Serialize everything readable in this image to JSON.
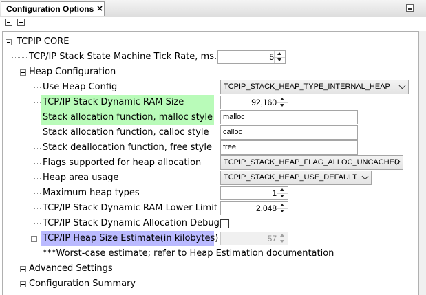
{
  "panel": {
    "title": "Configuration Options",
    "close_glyph": "×",
    "collapse_all_icon": "minus-box-icon",
    "expand_all_icon": "plus-box-icon"
  },
  "tree": {
    "root_label": "TCPIP CORE",
    "tick_rate": {
      "label": "TCP/IP Stack State Machine Tick Rate, ms.",
      "value": "5"
    },
    "heap_config": {
      "label": "Heap Configuration",
      "use_heap_config": {
        "label": "Use Heap Config",
        "value": "TCPIP_STACK_HEAP_TYPE_INTERNAL_HEAP"
      },
      "dynamic_ram_size": {
        "label": "TCP/IP Stack Dynamic RAM Size",
        "value": "92,160"
      },
      "malloc_func": {
        "label": "Stack allocation function, malloc style",
        "value": "malloc"
      },
      "calloc_func": {
        "label": "Stack allocation function, calloc style",
        "value": "calloc"
      },
      "free_func": {
        "label": "Stack deallocation function, free style",
        "value": "free"
      },
      "heap_flags": {
        "label": "Flags supported for heap allocation",
        "value": "TCPIP_STACK_HEAP_FLAG_ALLOC_UNCACHED"
      },
      "heap_usage": {
        "label": "Heap area usage",
        "value": "TCPIP_STACK_HEAP_USE_DEFAULT"
      },
      "max_heap_types": {
        "label": "Maximum heap types",
        "value": "1"
      },
      "ram_lower_limit": {
        "label": "TCP/IP Stack Dynamic RAM Lower Limit",
        "value": "2,048"
      },
      "alloc_debug": {
        "label": "TCP/IP Stack Dynamic Allocation Debug",
        "checked": false
      },
      "heap_size_estimate": {
        "label": "TCP/IP Heap Size Estimate(in kilobytes)",
        "value": "57"
      },
      "worst_case_note": "***Worst-case estimate; refer to Heap Estimation documentation"
    },
    "advanced_settings": {
      "label": "Advanced Settings"
    },
    "config_summary": {
      "label": "Configuration Summary"
    }
  },
  "colors": {
    "highlight_green": "#b9fbb9",
    "highlight_blue": "#babaff"
  }
}
